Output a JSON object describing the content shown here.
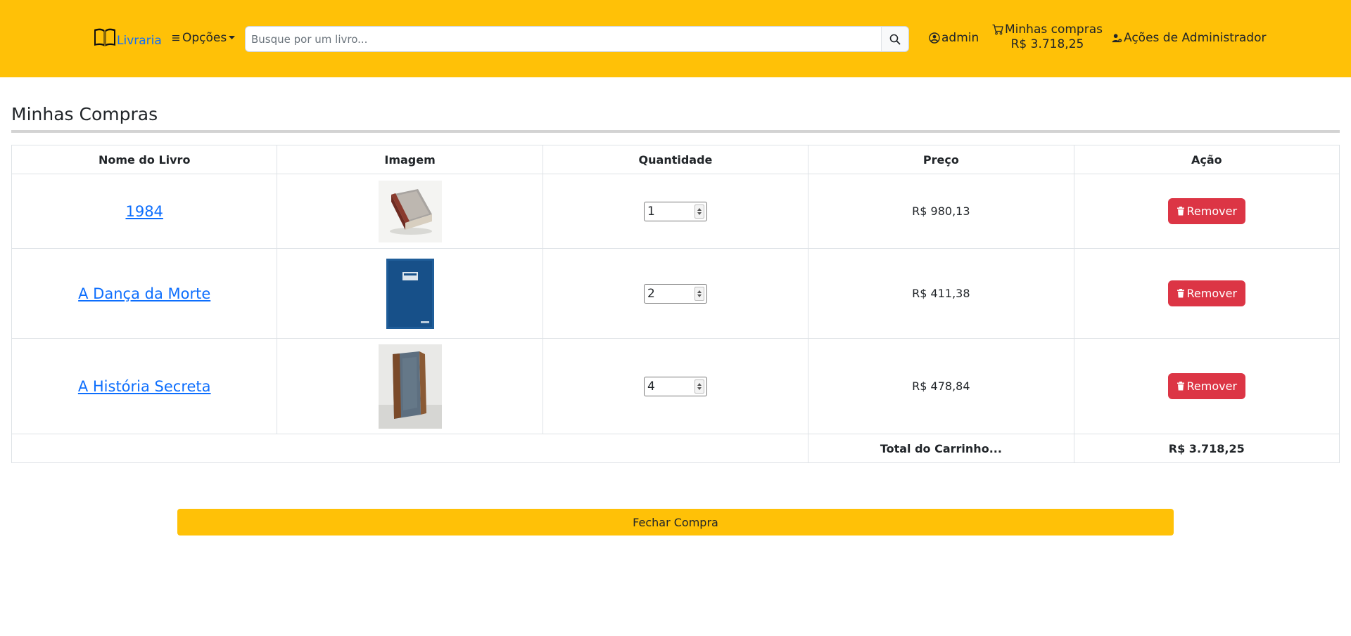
{
  "header": {
    "brand": "Livraria",
    "options_label": "Opções",
    "search_placeholder": "Busque por um livro...",
    "user_label": "admin",
    "cart_label": "Minhas compras",
    "cart_total": "R$ 3.718,25",
    "admin_actions_label": "Ações de Administrador"
  },
  "page": {
    "title": "Minhas Compras"
  },
  "table": {
    "headers": [
      "Nome do Livro",
      "Imagem",
      "Quantidade",
      "Preço",
      "Ação"
    ],
    "rows": [
      {
        "name": "1984",
        "quantity": "1",
        "price": "R$ 980,13",
        "action": "Remover"
      },
      {
        "name": "A Dança da Morte",
        "quantity": "2",
        "price": "R$ 411,38",
        "action": "Remover"
      },
      {
        "name": "A História Secreta",
        "quantity": "4",
        "price": "R$ 478,84",
        "action": "Remover"
      }
    ],
    "total_label": "Total do Carrinho...",
    "total_value": "R$ 3.718,25"
  },
  "checkout_label": "Fechar Compra",
  "colors": {
    "header_bg": "#ffc107",
    "link": "#0d6efd",
    "danger": "#dc3545"
  }
}
